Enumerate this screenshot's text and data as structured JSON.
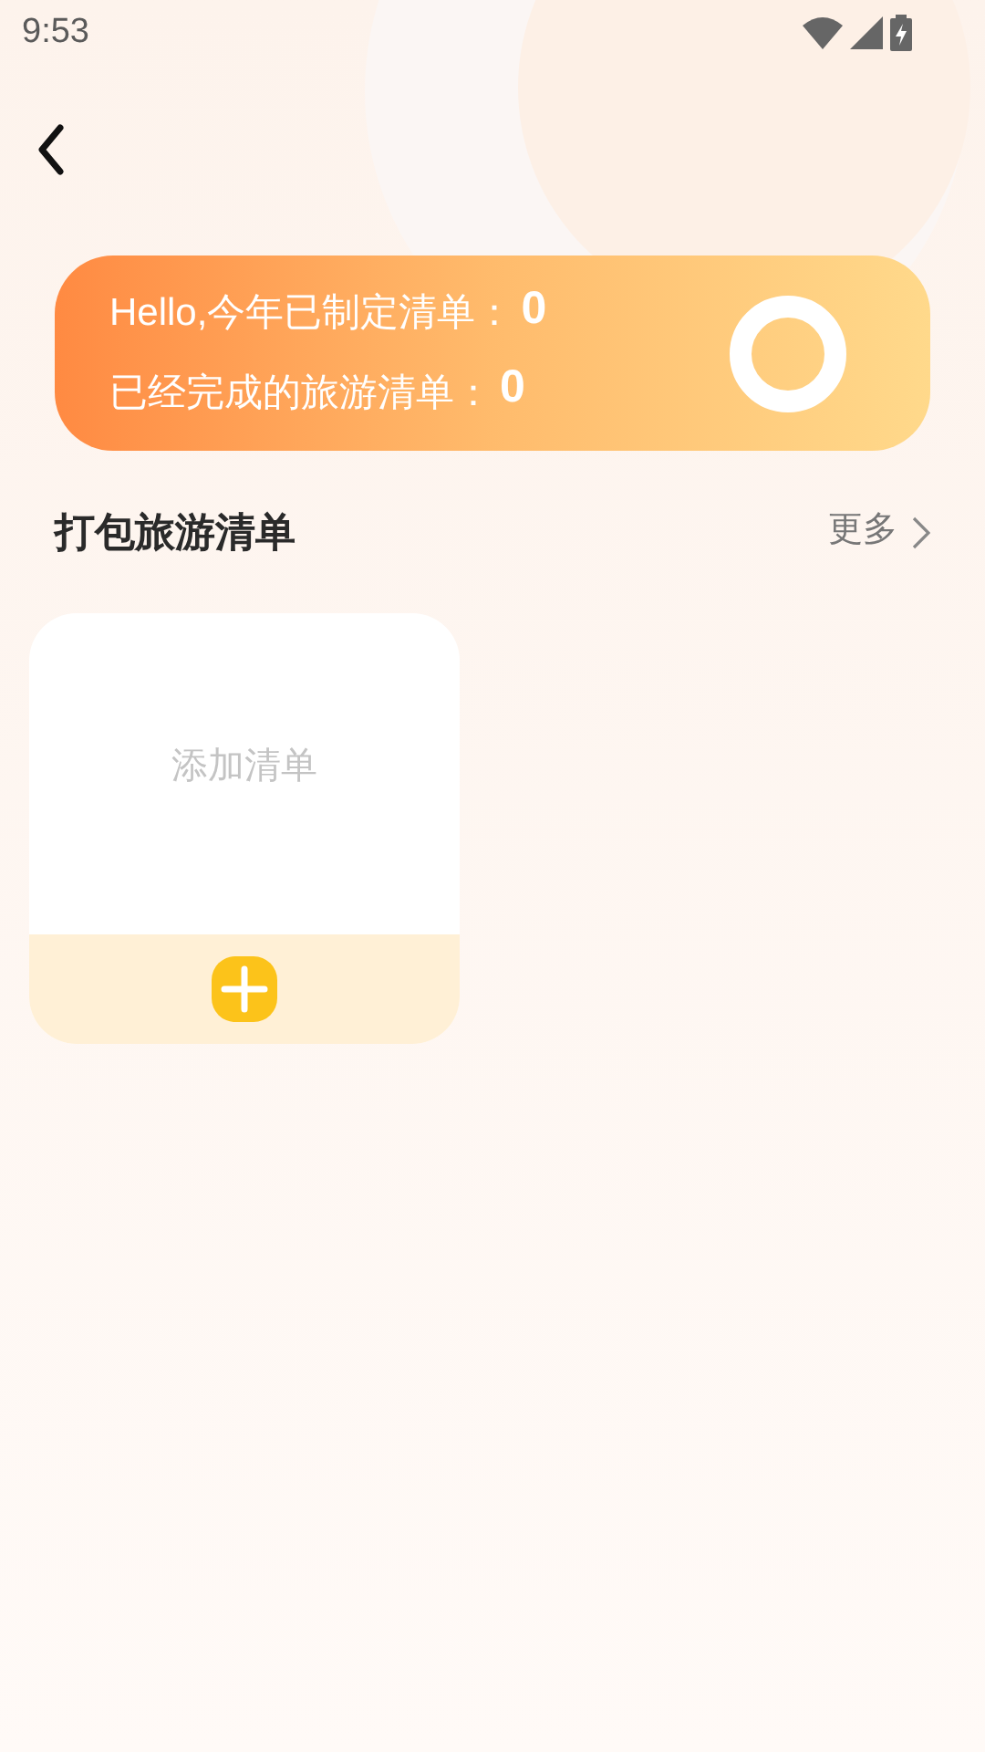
{
  "status_bar": {
    "time": "9:53"
  },
  "summary": {
    "stats": [
      {
        "label": "Hello,今年已制定清单：",
        "value": "0"
      },
      {
        "label": "已经完成的旅游清单：",
        "value": "0"
      }
    ]
  },
  "section": {
    "title": "打包旅游清单",
    "more": "更多"
  },
  "lists": [
    {
      "kind": "add",
      "label": "添加清单"
    }
  ]
}
